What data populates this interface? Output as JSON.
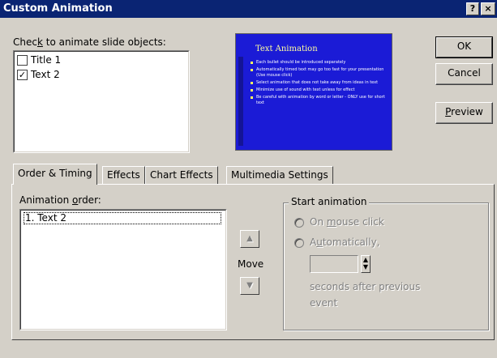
{
  "window": {
    "title": "Custom Animation",
    "help_label": "?",
    "close_label": "×"
  },
  "objects": {
    "label": "Check to animate slide objects:",
    "items": [
      {
        "label": "Title 1",
        "checked": false
      },
      {
        "label": "Text 2",
        "checked": true
      }
    ]
  },
  "preview_slide": {
    "title": "Text Animation",
    "bullets": [
      "Each bullet should be introduced separately",
      "Automatically timed text may go too fast for your presentation (Use mouse click)",
      "Select animation that does not take away from ideas in text",
      "Minimize use of sound with text unless for effect",
      "Be careful with animation by word or letter - ONLY use for short text"
    ]
  },
  "buttons": {
    "ok": "OK",
    "cancel": "Cancel",
    "preview": "Preview"
  },
  "tabs": [
    {
      "label": "Order & Timing",
      "active": true
    },
    {
      "label": "Effects",
      "active": false
    },
    {
      "label": "Chart Effects",
      "active": false
    },
    {
      "label": "Multimedia Settings",
      "active": false
    }
  ],
  "order_timing": {
    "animation_order_label": "Animation order:",
    "animation_order_items": [
      "1. Text 2"
    ],
    "move_label": "Move",
    "start_animation": {
      "group_label": "Start animation",
      "on_mouse_click": "On mouse click",
      "automatically": "Automatically,",
      "seconds_value": "",
      "seconds_after_line1": "seconds after previous",
      "seconds_after_line2": "event"
    }
  },
  "colors": {
    "titlebar": "#0a2473",
    "dialog_bg": "#d4d0c8",
    "slide_bg": "#1b1bd6",
    "slide_title": "#ffffa0"
  }
}
